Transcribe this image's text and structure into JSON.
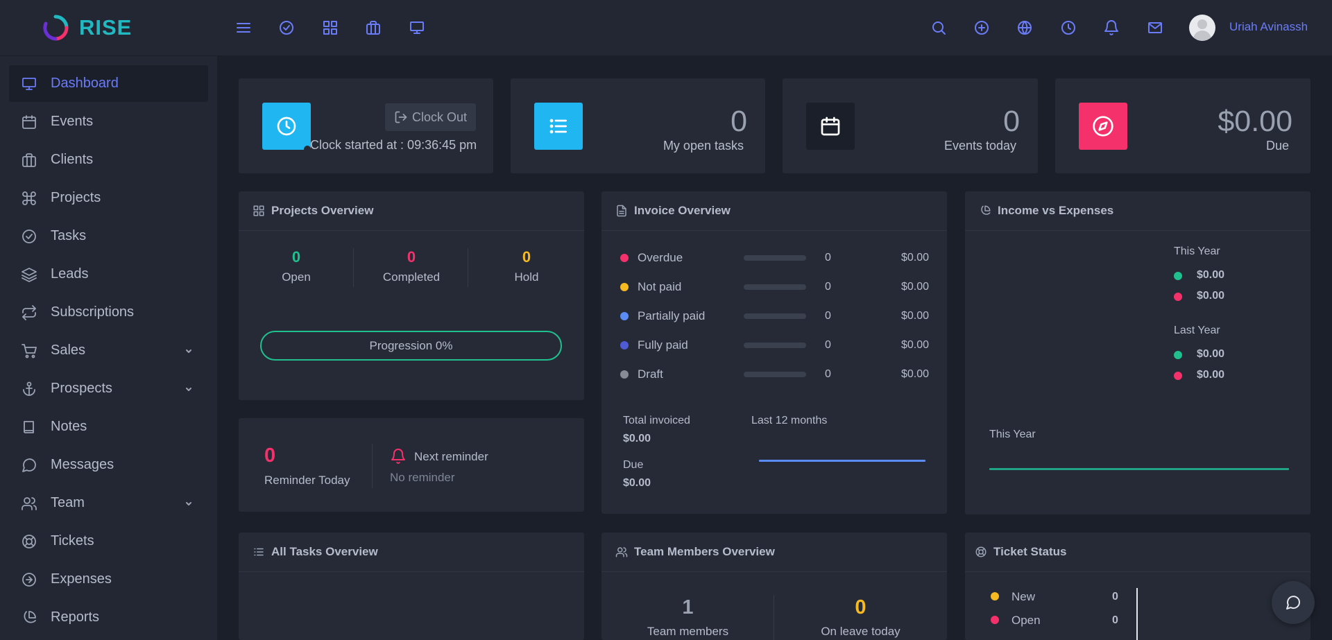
{
  "brand": {
    "name": "RISE"
  },
  "user": {
    "name": "Uriah Avinassh"
  },
  "topbar": {
    "left_icons": [
      "menu-icon",
      "check-circle-icon",
      "grid-icon",
      "briefcase-icon",
      "monitor-icon"
    ],
    "right_icons": [
      "search-icon",
      "plus-circle-icon",
      "globe-icon",
      "clock-icon",
      "bell-icon",
      "mail-icon"
    ]
  },
  "sidebar": {
    "items": [
      {
        "label": "Dashboard",
        "icon": "monitor-icon",
        "active": true
      },
      {
        "label": "Events",
        "icon": "calendar-icon"
      },
      {
        "label": "Clients",
        "icon": "briefcase-icon"
      },
      {
        "label": "Projects",
        "icon": "command-icon"
      },
      {
        "label": "Tasks",
        "icon": "check-circle-icon"
      },
      {
        "label": "Leads",
        "icon": "layers-icon"
      },
      {
        "label": "Subscriptions",
        "icon": "repeat-icon"
      },
      {
        "label": "Sales",
        "icon": "cart-icon",
        "expandable": true
      },
      {
        "label": "Prospects",
        "icon": "anchor-icon",
        "expandable": true
      },
      {
        "label": "Notes",
        "icon": "book-icon"
      },
      {
        "label": "Messages",
        "icon": "message-icon"
      },
      {
        "label": "Team",
        "icon": "users-icon",
        "expandable": true
      },
      {
        "label": "Tickets",
        "icon": "life-buoy-icon"
      },
      {
        "label": "Expenses",
        "icon": "arrow-circle-icon"
      },
      {
        "label": "Reports",
        "icon": "pie-chart-icon"
      }
    ]
  },
  "clock": {
    "button": "Clock Out",
    "started": "Clock started at : 09:36:45 pm",
    "color": "#1fb6f2"
  },
  "stats": {
    "tasks": {
      "value": "0",
      "label": "My open tasks",
      "color": "#1fb6f2"
    },
    "events": {
      "value": "0",
      "label": "Events today",
      "color": "#1b1f2a"
    },
    "due": {
      "value": "$0.00",
      "label": "Due",
      "color": "#f5316c"
    }
  },
  "projects_overview": {
    "title": "Projects Overview",
    "open": {
      "value": "0",
      "label": "Open",
      "color": "#1fc08e"
    },
    "completed": {
      "value": "0",
      "label": "Completed",
      "color": "#f5316c"
    },
    "hold": {
      "value": "0",
      "label": "Hold",
      "color": "#f5b921"
    },
    "progression": "Progression 0%"
  },
  "reminder": {
    "count": "0",
    "label": "Reminder Today",
    "next_title": "Next reminder",
    "next_value": "No reminder"
  },
  "invoice_overview": {
    "title": "Invoice Overview",
    "rows": [
      {
        "label": "Overdue",
        "count": "0",
        "amount": "$0.00",
        "color": "#f5316c"
      },
      {
        "label": "Not paid",
        "count": "0",
        "amount": "$0.00",
        "color": "#f5b921"
      },
      {
        "label": "Partially paid",
        "count": "0",
        "amount": "$0.00",
        "color": "#5b8cf5"
      },
      {
        "label": "Fully paid",
        "count": "0",
        "amount": "$0.00",
        "color": "#4f5bd5"
      },
      {
        "label": "Draft",
        "count": "0",
        "amount": "$0.00",
        "color": "#868b95"
      }
    ],
    "total_label": "Total invoiced",
    "total_value": "$0.00",
    "due_label": "Due",
    "due_value": "$0.00",
    "period": "Last 12 months"
  },
  "income_expenses": {
    "title": "Income vs Expenses",
    "this_year": "This Year",
    "last_year": "Last Year",
    "this_year_income": "$0.00",
    "this_year_expense": "$0.00",
    "last_year_income": "$0.00",
    "last_year_expense": "$0.00",
    "chart_label": "This Year",
    "income_color": "#1fc08e",
    "expense_color": "#f5316c"
  },
  "all_tasks": {
    "title": "All Tasks Overview"
  },
  "team_overview": {
    "title": "Team Members Overview",
    "members_value": "1",
    "members_label": "Team members",
    "leave_value": "0",
    "leave_label": "On leave today"
  },
  "ticket_status": {
    "title": "Ticket Status",
    "rows": [
      {
        "label": "New",
        "count": "0",
        "color": "#f5b921"
      },
      {
        "label": "Open",
        "count": "0",
        "color": "#f5316c"
      }
    ]
  }
}
